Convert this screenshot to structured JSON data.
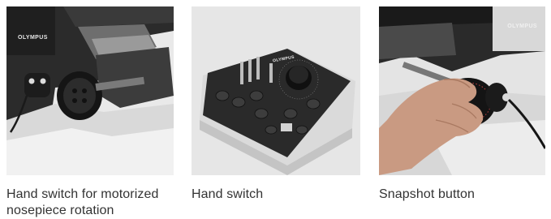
{
  "cards": [
    {
      "caption": "Hand switch for motorized nosepiece rotation",
      "brand": "OLYMPUS"
    },
    {
      "caption": "Hand switch",
      "brand": "OLYMPUS"
    },
    {
      "caption": "Snapshot button",
      "brand": "OLYMPUS"
    }
  ],
  "colors": {
    "caption_text": "#333333",
    "photo_background": "#ececec"
  }
}
